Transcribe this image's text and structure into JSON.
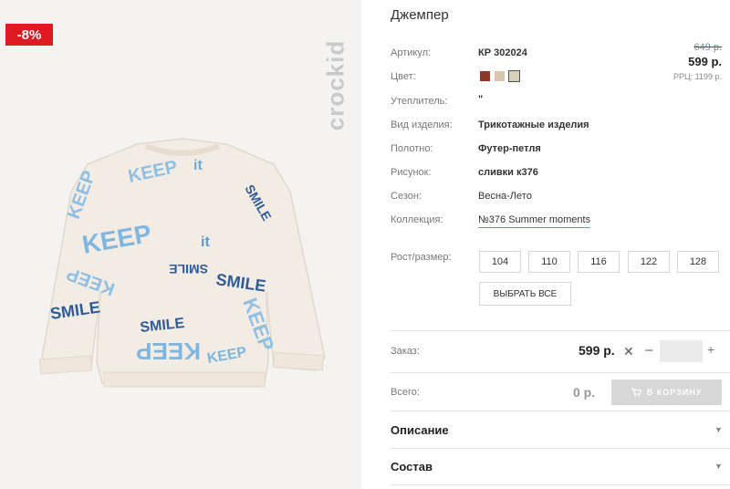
{
  "product": {
    "title": "Джемпер",
    "badge": "-8%",
    "brand_logo_text": "crockid"
  },
  "price": {
    "old": "649 р.",
    "current": "599 р.",
    "rrp": "РРЦ: 1199 р."
  },
  "attributes": {
    "article": {
      "label": "Артикул:",
      "value": "КР 302024"
    },
    "color": {
      "label": "Цвет:",
      "swatches": [
        "#8a3a26",
        "#d8c7ae",
        "#d9cfb6"
      ]
    },
    "insulation": {
      "label": "Утеплитель:",
      "value": "\""
    },
    "type": {
      "label": "Вид изделия:",
      "value": "Трикотажные изделия"
    },
    "fabric": {
      "label": "Полотно:",
      "value": "Футер-петля"
    },
    "pattern": {
      "label": "Рисунок:",
      "value": "сливки к376"
    },
    "season": {
      "label": "Сезон:",
      "value": "Весна-Лето"
    },
    "collection": {
      "label": "Коллекция:",
      "value": "№376 Summer moments"
    }
  },
  "sizes": {
    "label": "Рост/размер:",
    "options": [
      "104",
      "110",
      "116",
      "122",
      "128"
    ],
    "select_all": "ВЫБРАТЬ ВСЕ"
  },
  "order": {
    "label": "Заказ:",
    "price": "599 р.",
    "clear_symbol": "✕",
    "minus": "–",
    "plus": "+",
    "quantity": ""
  },
  "total": {
    "label": "Всего:",
    "value": "0 р.",
    "cart_button": "В КОРЗИНУ"
  },
  "accordion": {
    "description": "Описание",
    "composition": "Состав",
    "arrow": "▼"
  },
  "print_words": {
    "keep": "KEEP",
    "it": "it",
    "smile": "SMILE"
  }
}
